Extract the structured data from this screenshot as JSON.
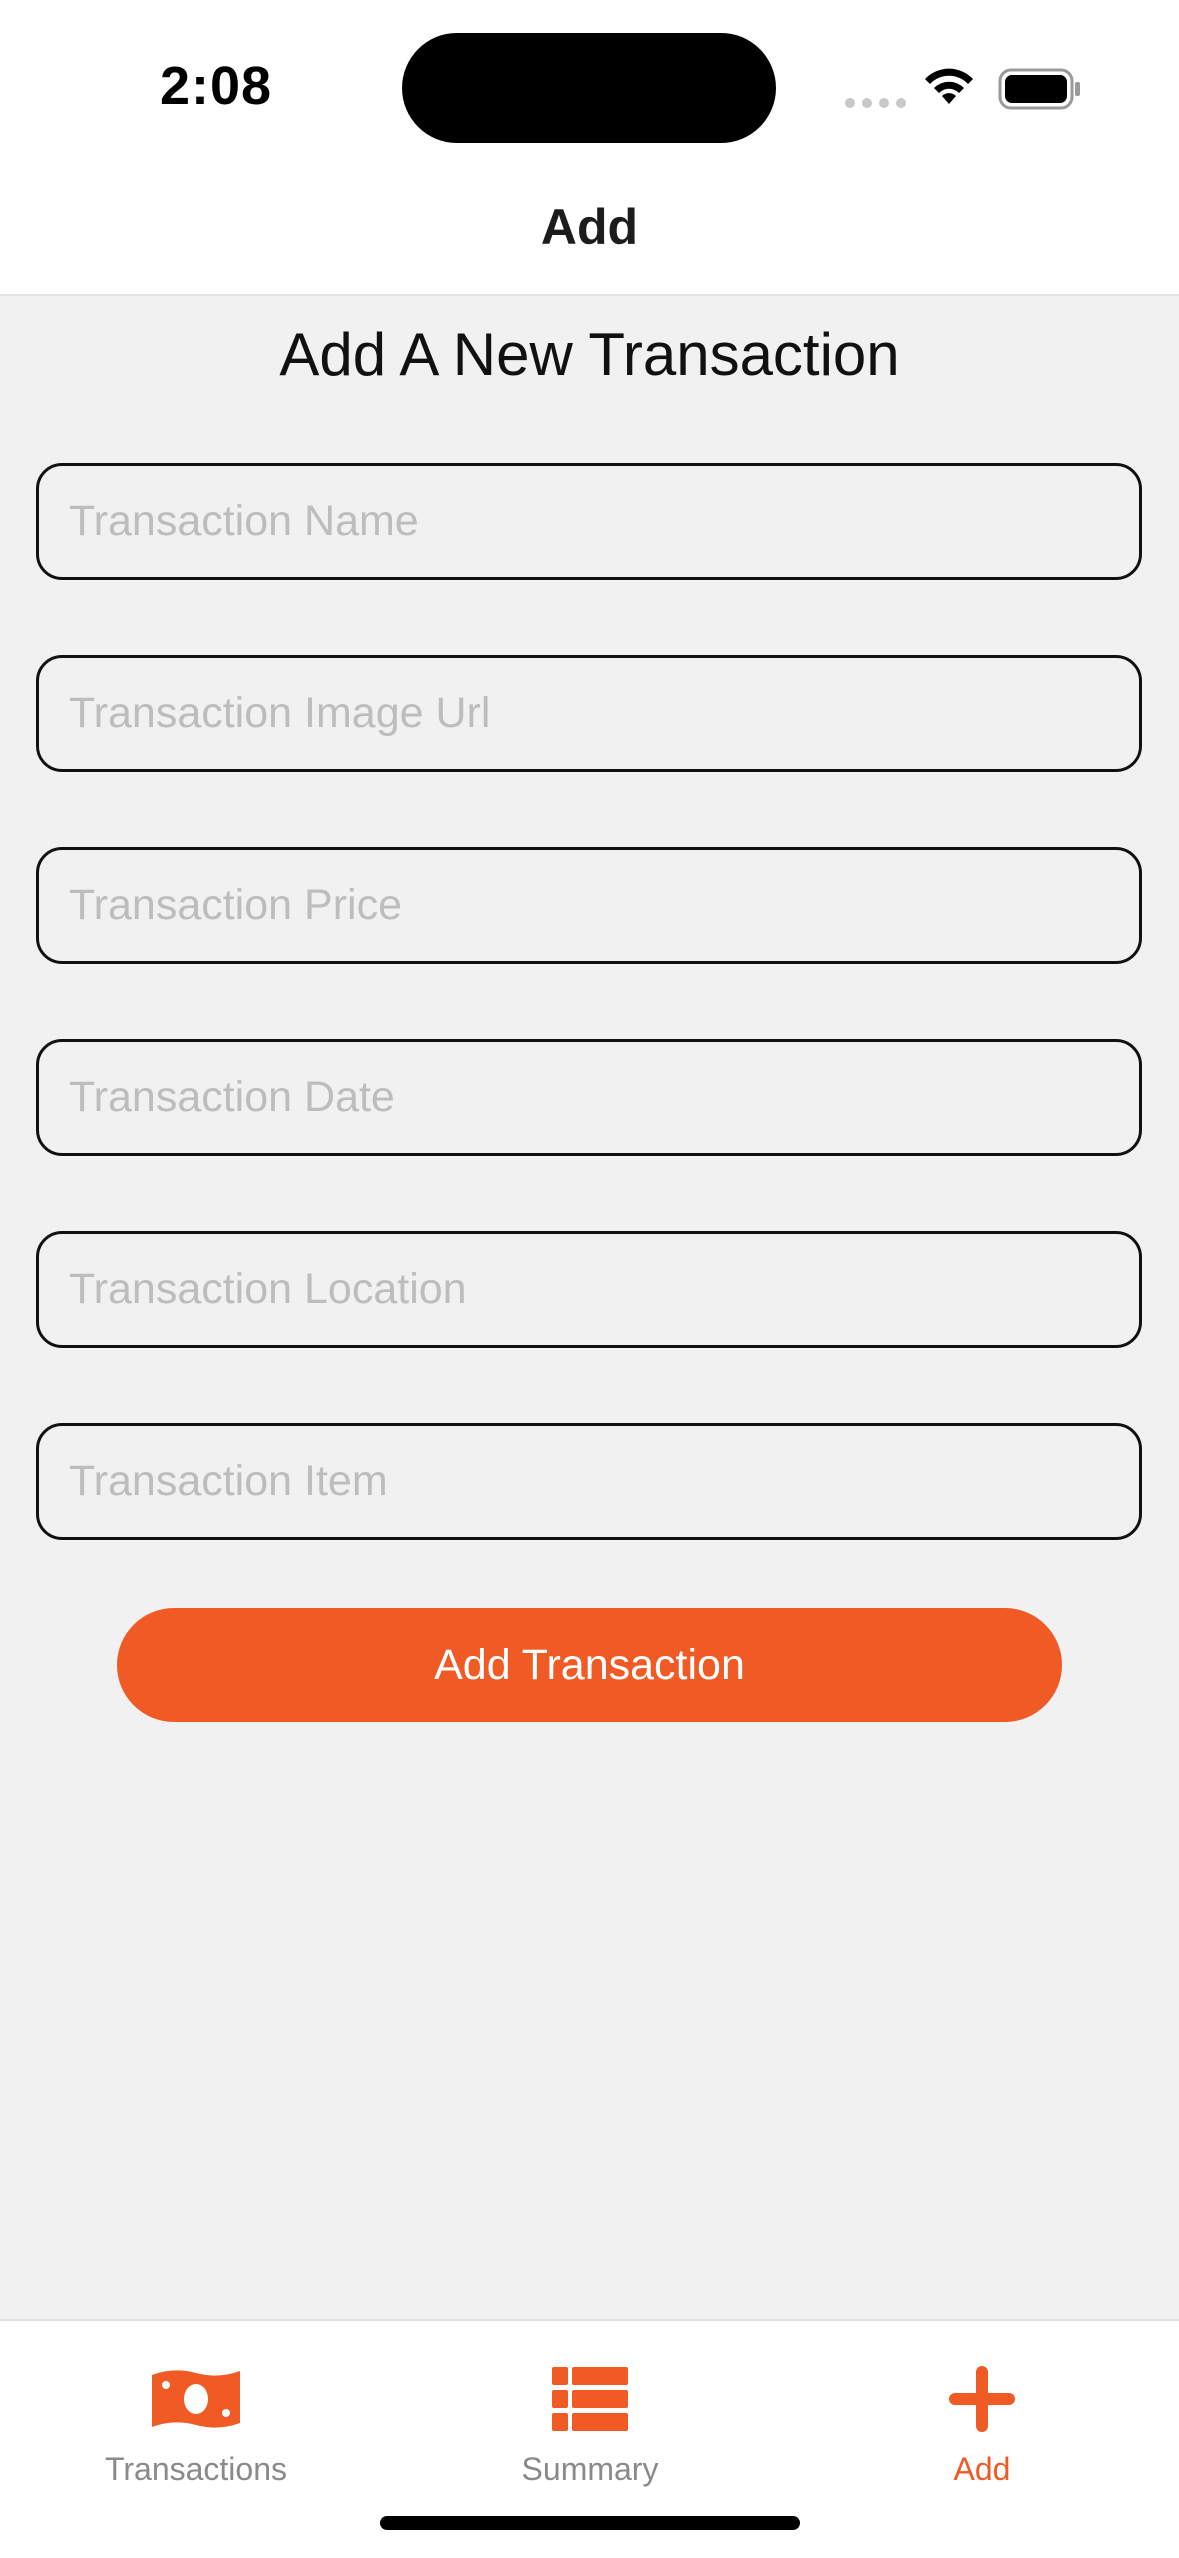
{
  "status_bar": {
    "time": "2:08"
  },
  "nav": {
    "title": "Add"
  },
  "form": {
    "heading": "Add A New Transaction",
    "fields": [
      {
        "placeholder": "Transaction Name",
        "value": ""
      },
      {
        "placeholder": "Transaction Image Url",
        "value": ""
      },
      {
        "placeholder": "Transaction Price",
        "value": ""
      },
      {
        "placeholder": "Transaction Date",
        "value": ""
      },
      {
        "placeholder": "Transaction Location",
        "value": ""
      },
      {
        "placeholder": "Transaction Item",
        "value": ""
      }
    ],
    "submit_label": "Add Transaction"
  },
  "tab_bar": {
    "items": [
      {
        "label": "Transactions",
        "icon": "banknote-icon",
        "active": false
      },
      {
        "label": "Summary",
        "icon": "list-icon",
        "active": false
      },
      {
        "label": "Add",
        "icon": "plus-icon",
        "active": true
      }
    ]
  },
  "colors": {
    "accent": "#f05a24",
    "background": "#f1f1f1",
    "inactive_tab": "#8a8a8a"
  }
}
